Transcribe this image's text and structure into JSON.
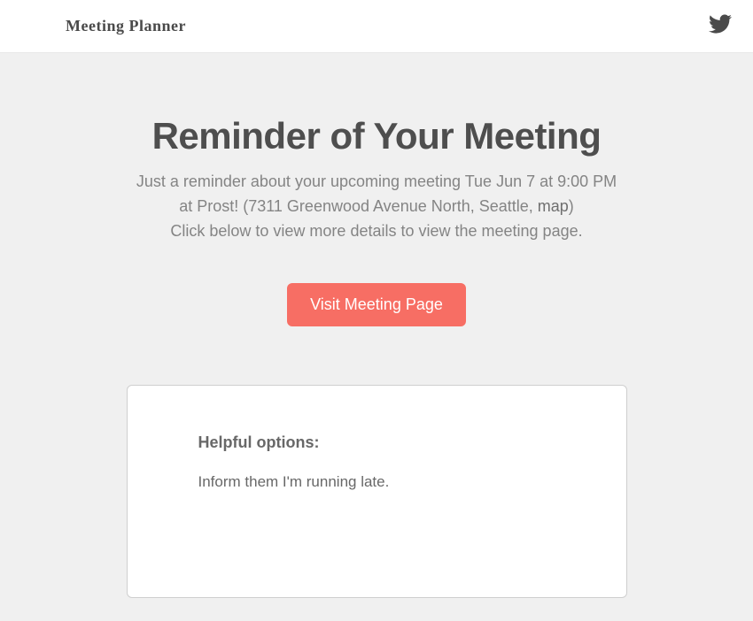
{
  "header": {
    "brand": "Meeting Planner"
  },
  "main": {
    "title": "Reminder of Your Meeting",
    "subtitle_line1": "Just a reminder about your upcoming meeting Tue Jun 7 at 9:00 PM  at Prost!  (7311 Greenwood Avenue North, Seattle, ",
    "map_link_text": "map",
    "subtitle_line1_end": ")",
    "subtitle_line2": "Click below to view more details to view the meeting page.",
    "cta_label": "Visit Meeting Page"
  },
  "options": {
    "heading": "Helpful options:",
    "items": [
      "Inform them I'm running late."
    ]
  }
}
